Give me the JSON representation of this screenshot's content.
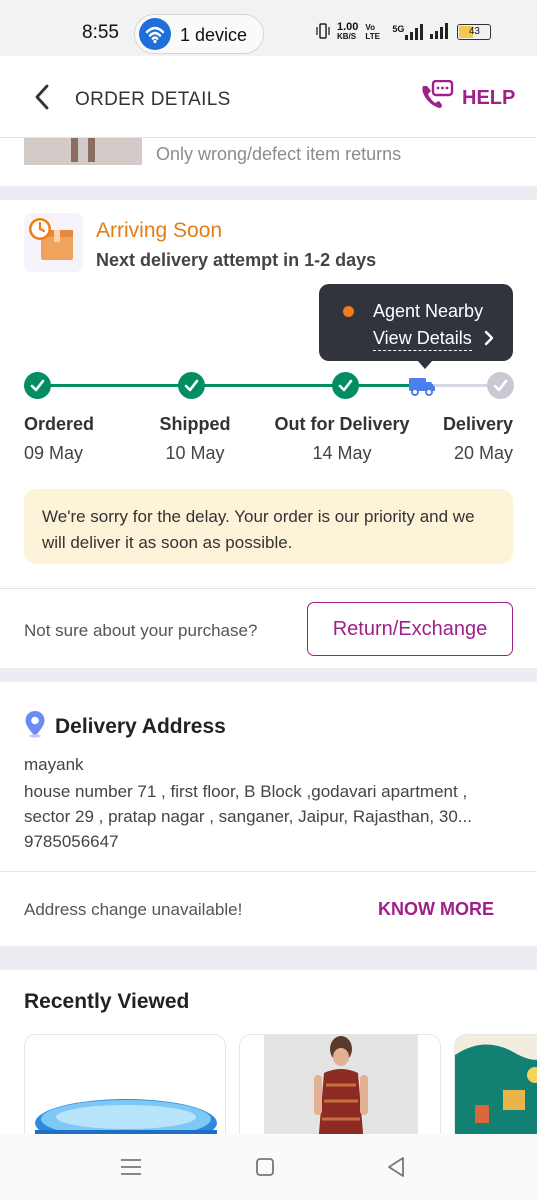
{
  "status_bar": {
    "time": "8:55",
    "device_pill": "1 device",
    "network_speed_top": "1.00",
    "network_speed_unit": "KB/S",
    "volte": "Vo LTE",
    "network_type": "5G",
    "battery": "43"
  },
  "header": {
    "title": "ORDER DETAILS",
    "help_label": "HELP"
  },
  "product_strip": {
    "returns_note": "Only wrong/defect item returns"
  },
  "arrival": {
    "title": "Arriving Soon",
    "subtitle": "Next delivery attempt in 1-2 days"
  },
  "tooltip": {
    "status": "Agent Nearby",
    "link": "View Details"
  },
  "tracking": {
    "steps": [
      {
        "name": "Ordered",
        "date": "09 May",
        "done": true
      },
      {
        "name": "Shipped",
        "date": "10 May",
        "done": true
      },
      {
        "name": "Out for Delivery",
        "date": "14 May",
        "done": true
      },
      {
        "name": "Delivery",
        "date": "20 May",
        "done": false
      }
    ]
  },
  "delay_message": "We're sorry for the delay. Your order is our priority and we will deliver it as soon as possible.",
  "return_section": {
    "question": "Not sure about your purchase?",
    "button": "Return/Exchange"
  },
  "address": {
    "title": "Delivery Address",
    "name": "mayank",
    "line1": "house number 71 , first floor, B Block ,godavari apartment ,",
    "line2": "sector 29 , pratap nagar , sanganer, Jaipur, Rajasthan, 30...",
    "phone": "9785056647",
    "change_note": "Address change unavailable!",
    "know_more": "KNOW MORE"
  },
  "recently_viewed": {
    "title": "Recently Viewed"
  },
  "colors": {
    "brand": "#9f2089",
    "success": "#038d63",
    "arriving": "#e27d16",
    "delay_bg": "#fdf3d8"
  }
}
